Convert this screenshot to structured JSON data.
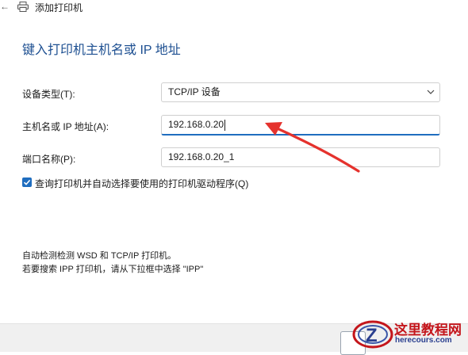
{
  "window": {
    "back_icon": "arrow-left-icon",
    "printer_icon": "printer-icon",
    "title": "添加打印机"
  },
  "heading": "键入打印机主机名或 IP 地址",
  "form": {
    "device_type_label": "设备类型(T):",
    "device_type_value": "TCP/IP 设备",
    "hostname_label": "主机名或 IP 地址(A):",
    "hostname_value": "192.168.0.20",
    "port_label": "端口名称(P):",
    "port_value": "192.168.0.20_1",
    "query_checkbox_label": "查询打印机并自动选择要使用的打印机驱动程序(Q)",
    "query_checkbox_checked": true
  },
  "info": {
    "line1": "自动检测检测 WSD 和 TCP/IP 打印机。",
    "line2": "若要搜索 IPP 打印机，请从下拉框中选择 \"IPP\""
  },
  "annotation": {
    "arrow_color": "#e5322d"
  },
  "watermark": {
    "logo_letter": "Z",
    "text": "这里教程网",
    "url": "herecours.com"
  },
  "colors": {
    "accent": "#1f6dbf",
    "heading": "#1d4f91"
  }
}
